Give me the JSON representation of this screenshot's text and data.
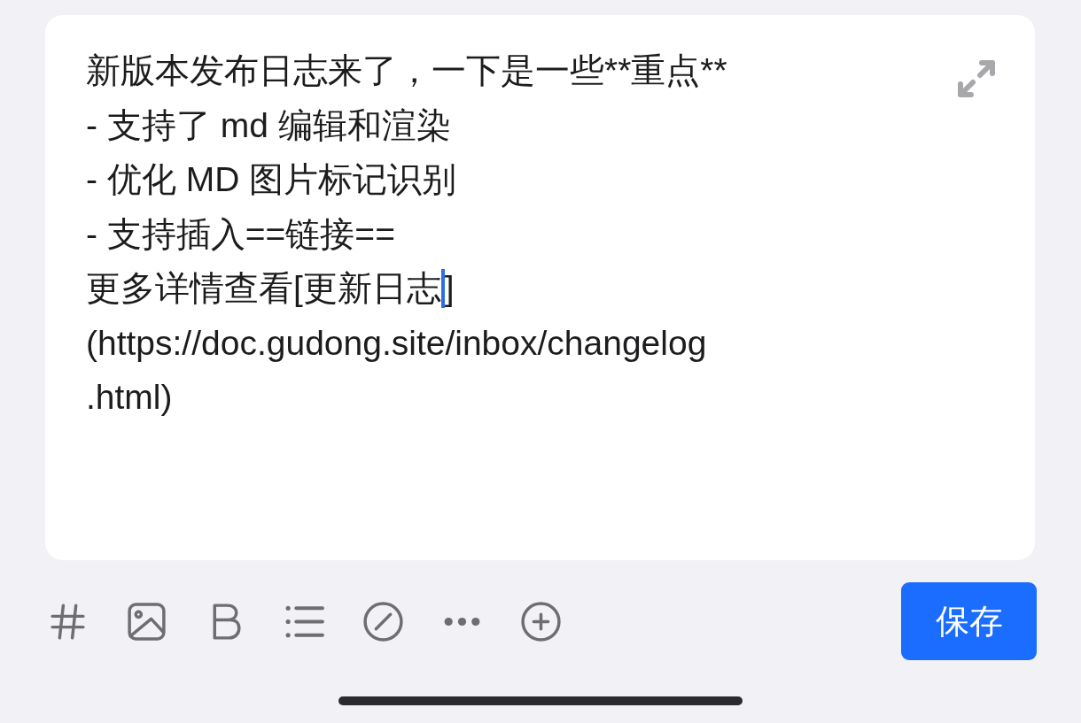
{
  "editor": {
    "lines": [
      {
        "text": "新版本发布日志来了，一下是一些**重点**"
      },
      {
        "text": "- 支持了 md 编辑和渲染"
      },
      {
        "text": "- 优化 MD 图片标记识别"
      },
      {
        "text": "- 支持插入==链接=="
      },
      {
        "text": "更多详情查看[更新日志",
        "text_after_caret": "]"
      },
      {
        "text": "(https://doc.gudong.site/inbox/changelog"
      },
      {
        "text": ".html)"
      }
    ]
  },
  "toolbar": {
    "tools": [
      {
        "kind": "hashtag"
      },
      {
        "kind": "image"
      },
      {
        "kind": "bold"
      },
      {
        "kind": "list"
      },
      {
        "kind": "slash"
      },
      {
        "kind": "more"
      },
      {
        "kind": "add"
      }
    ],
    "save_button": "保存"
  }
}
